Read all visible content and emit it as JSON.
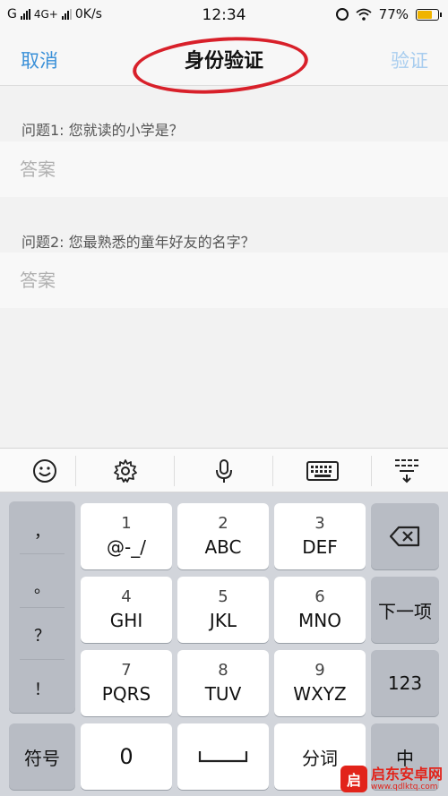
{
  "status_bar": {
    "carrier1": "G",
    "carrier2": "4G+",
    "speed": "0K/s",
    "time": "12:34",
    "battery": "77%",
    "battery_level": 0.77
  },
  "nav": {
    "cancel_label": "取消",
    "title": "身份验证",
    "verify_label": "验证"
  },
  "questions": [
    {
      "label": "问题1: 您就读的小学是？",
      "placeholder": "答案"
    },
    {
      "label": "问题2: 您最熟悉的童年好友的名字？",
      "placeholder": "答案"
    }
  ],
  "keyboard": {
    "toolbar": [
      "emoji-icon",
      "gear-icon",
      "microphone-icon",
      "keyboard-icon",
      "collapse-keyboard-icon"
    ],
    "punct": [
      "，",
      "。",
      "？",
      "！"
    ],
    "keys": [
      {
        "num": "1",
        "letters": "@-_/"
      },
      {
        "num": "2",
        "letters": "ABC"
      },
      {
        "num": "3",
        "letters": "DEF"
      },
      {
        "num": "4",
        "letters": "GHI"
      },
      {
        "num": "5",
        "letters": "JKL"
      },
      {
        "num": "6",
        "letters": "MNO"
      },
      {
        "num": "7",
        "letters": "PQRS"
      },
      {
        "num": "8",
        "letters": "TUV"
      },
      {
        "num": "9",
        "letters": "WXYZ"
      }
    ],
    "next_label": "下一项",
    "numeric_label": "123",
    "symbols_label": "符号",
    "zero_label": "0",
    "space_label": "⎵",
    "segment_label": "分词",
    "lang_label": "中"
  },
  "watermark": {
    "name": "启东安卓网",
    "url": "www.qdlktq.com",
    "logo_char": "启"
  }
}
